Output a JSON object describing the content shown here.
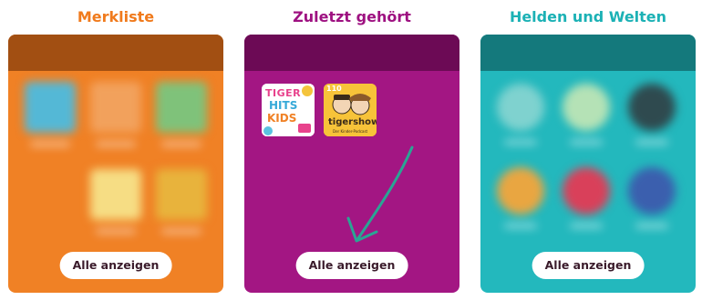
{
  "columns": [
    {
      "title": "Merkliste",
      "title_color": "#f07a1c",
      "card_color": "#f08125",
      "header_color": "#a24f12",
      "button_label": "Alle anzeigen"
    },
    {
      "title": "Zuletzt gehört",
      "title_color": "#9e1181",
      "card_color": "#a31683",
      "header_color": "#6c0a55",
      "button_label": "Alle anzeigen",
      "items": [
        {
          "title_lines": [
            "TIGER",
            "HITS",
            "KIDS"
          ],
          "icon": "tiger-hits-kids-cover"
        },
        {
          "badge": "110",
          "title": "tigershow",
          "subtitle": "Der Kinder-Podcast",
          "icon": "tigershow-cover"
        }
      ]
    },
    {
      "title": "Helden und Welten",
      "title_color": "#1bb1b5",
      "card_color": "#23b8bd",
      "header_color": "#14797c",
      "button_label": "Alle anzeigen"
    }
  ],
  "annotation": {
    "icon": "arrow-annotation",
    "color": "#2aa594"
  }
}
